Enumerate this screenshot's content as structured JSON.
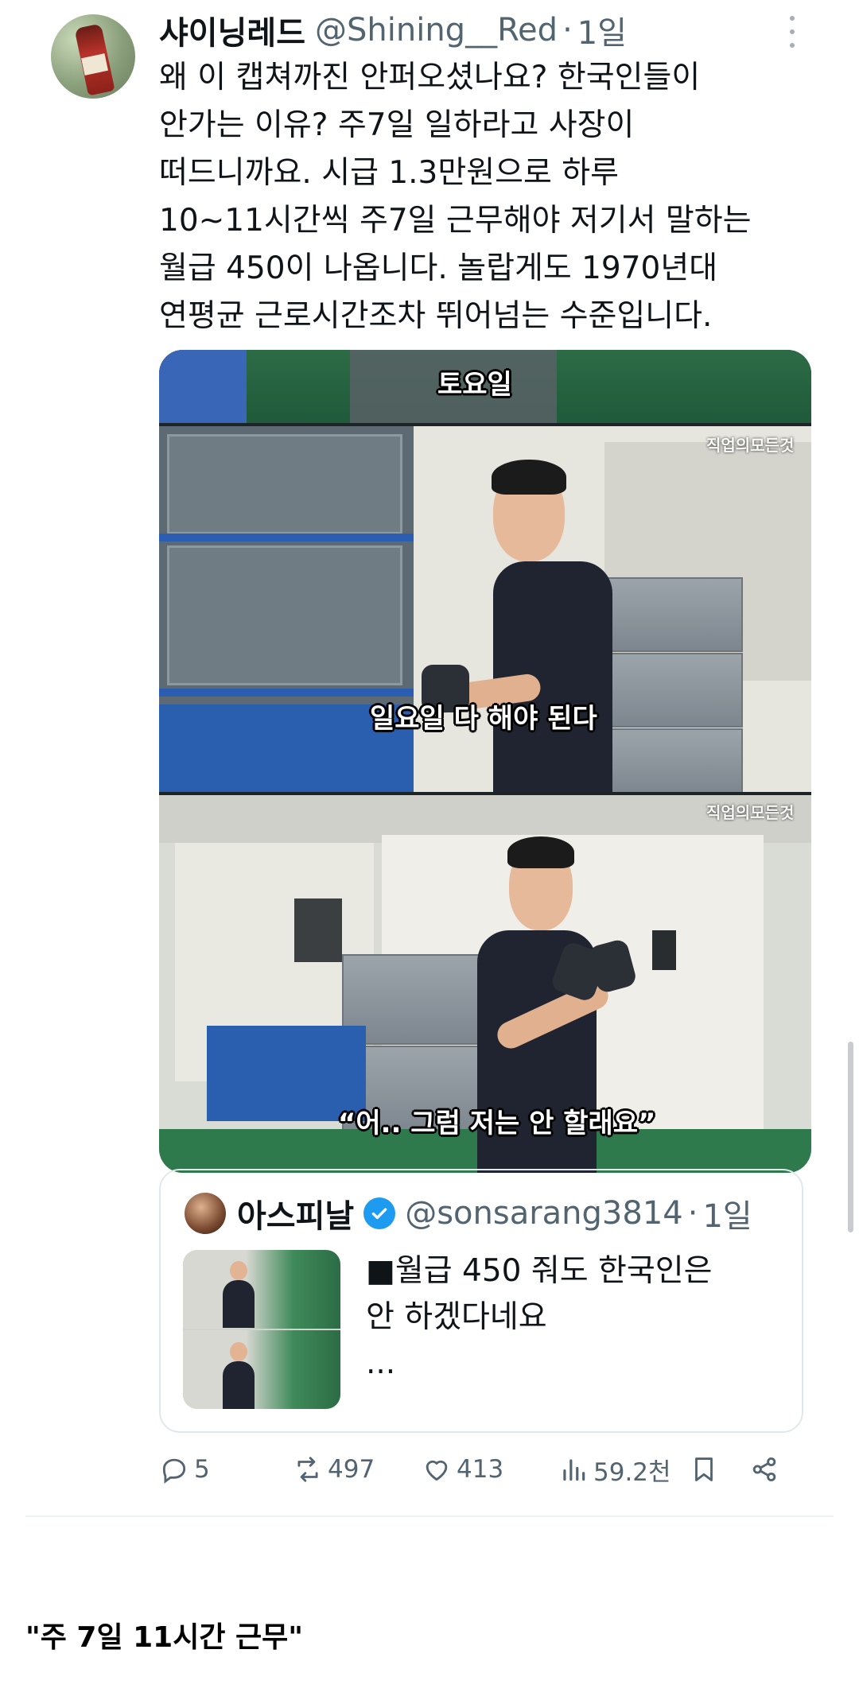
{
  "tweet": {
    "display_name": "샤이닝레드",
    "handle": "@Shining__Red",
    "separator": "·",
    "time": "1일",
    "text_lines": [
      "왜 이 캡쳐까진 안퍼오셨나요? 한국인들이",
      "안가는 이유? 주7일 일하라고 사장이",
      "떠드니까요. 시급 1.3만원으로 하루",
      "10~11시간씩 주7일 근무해야 저기서 말하는",
      "월급 450이 나옵니다. 놀랍게도 1970년대",
      "연평균 근로시간조차 뛰어넘는 수준입니다."
    ]
  },
  "media": {
    "panel1_subtitle": "토요일",
    "panel2_subtitle": "일요일 다 해야 된다",
    "panel3_subtitle": "“어.. 그럼 저는 안 할래요”",
    "watermark": "직업의모든것"
  },
  "quoted_tweet": {
    "display_name": "아스피날",
    "handle": "@sonsarang3814",
    "separator": "·",
    "time": "1일",
    "text_lines": [
      "■월급 450 줘도 한국인은",
      "안 하겠다네요",
      "..."
    ]
  },
  "actions": {
    "replies": "5",
    "retweets": "497",
    "likes": "413",
    "views": "59.2천"
  },
  "colors": {
    "text_primary": "#0f1419",
    "text_secondary": "#536471",
    "verified_blue": "#1d9bf0"
  },
  "caption": "\"주 7일 11시간 근무\""
}
